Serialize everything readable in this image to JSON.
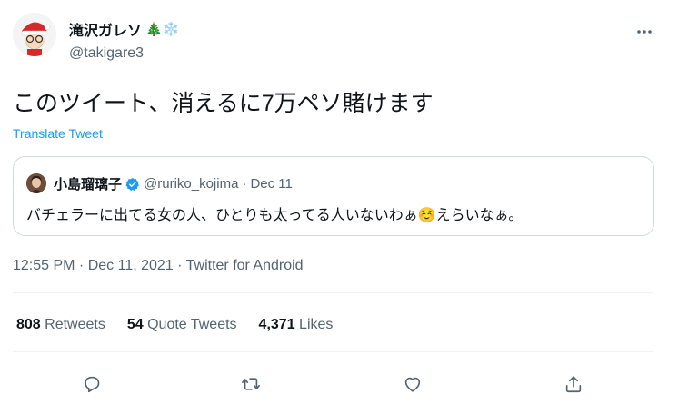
{
  "author": {
    "display_name": "滝沢ガレソ",
    "name_emoji": "🎄❄️",
    "handle": "@takigare3"
  },
  "tweet": {
    "text": "このツイート、消えるに7万ペソ賭けます",
    "translate_label": "Translate Tweet"
  },
  "quoted": {
    "display_name": "小島瑠璃子",
    "handle": "@ruriko_kojima",
    "separator": "·",
    "date": "Dec 11",
    "text": "バチェラーに出てる女の人、ひとりも太ってる人いないわぁ☺️えらいなぁ。"
  },
  "meta": {
    "text": "12:55 PM · Dec 11, 2021 · Twitter for Android"
  },
  "stats": {
    "retweets_count": "808",
    "retweets_label": "Retweets",
    "quotes_count": "54",
    "quotes_label": "Quote Tweets",
    "likes_count": "4,371",
    "likes_label": "Likes"
  },
  "actions": [
    "reply-icon",
    "retweet-icon",
    "like-icon",
    "share-icon"
  ],
  "colors": {
    "link": "#1d9bf0",
    "secondary_text": "#536471",
    "border": "#cfd9de",
    "verified": "#1d9bf0"
  }
}
